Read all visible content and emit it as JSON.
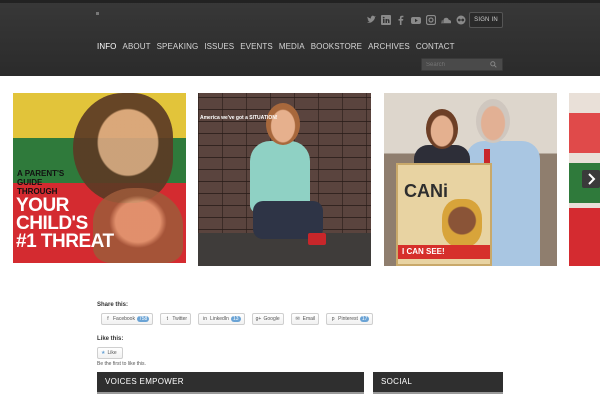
{
  "header": {
    "signin_label": "SIGN IN",
    "nav": [
      "INFO",
      "ABOUT",
      "SPEAKING",
      "ISSUES",
      "EVENTS",
      "MEDIA",
      "BOOKSTORE",
      "ARCHIVES",
      "CONTACT"
    ],
    "search_placeholder": "Search",
    "social_icons": [
      "twitter-icon",
      "linkedin-icon",
      "facebook-icon",
      "youtube-icon",
      "instagram-icon",
      "soundcloud-icon",
      "flickr-icon",
      "google-icon"
    ]
  },
  "gallery": {
    "tile1": {
      "small_text_lines": [
        "A PARENT'S",
        "GUIDE",
        "THROUGH"
      ],
      "big_text_lines": [
        "YOUR",
        "CHILD'S",
        "#1 THREAT"
      ]
    },
    "tile2": {
      "caption": "America we've got a SITUATION!"
    },
    "tile3": {
      "book_title": "CANi",
      "book_band": "I CAN SEE!",
      "book_see": "SEE"
    }
  },
  "share": {
    "title": "Share this:",
    "buttons": [
      {
        "label": "Facebook",
        "count": "758",
        "icon": "facebook-icon"
      },
      {
        "label": "Twitter",
        "count": "",
        "icon": "twitter-icon"
      },
      {
        "label": "LinkedIn",
        "count": "13",
        "icon": "linkedin-icon"
      },
      {
        "label": "Google",
        "count": "",
        "icon": "google-plus-icon"
      },
      {
        "label": "Email",
        "count": "",
        "icon": "email-icon"
      },
      {
        "label": "Pinterest",
        "count": "17",
        "icon": "pinterest-icon"
      }
    ]
  },
  "like": {
    "title": "Like this:",
    "button_label": "Like",
    "note": "Be the first to like this."
  },
  "widgets": {
    "voices_title": "VOICES EMPOWER",
    "social_title": "SOCIAL"
  }
}
